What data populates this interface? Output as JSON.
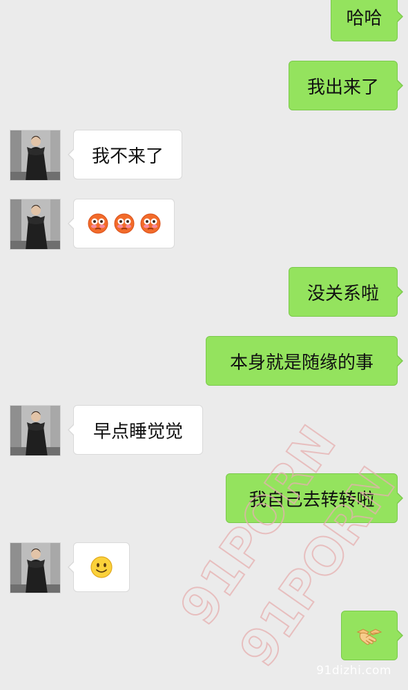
{
  "messages": [
    {
      "side": "out",
      "kind": "text",
      "text": "哈哈"
    },
    {
      "side": "out",
      "kind": "text",
      "text": "我出来了"
    },
    {
      "side": "in",
      "kind": "text",
      "text": "我不来了"
    },
    {
      "side": "in",
      "kind": "emoji",
      "icon": "flushed-face-icon",
      "count": 3
    },
    {
      "side": "out",
      "kind": "text",
      "text": "没关系啦"
    },
    {
      "side": "out",
      "kind": "text",
      "text": "本身就是随缘的事"
    },
    {
      "side": "in",
      "kind": "text",
      "text": "早点睡觉觉"
    },
    {
      "side": "out",
      "kind": "text",
      "text": "我自己去转转啦"
    },
    {
      "side": "in",
      "kind": "emoji",
      "icon": "smiling-face-icon",
      "count": 1
    },
    {
      "side": "out",
      "kind": "emoji",
      "icon": "handshake-icon",
      "count": 1
    }
  ],
  "watermark": {
    "line1": "91PORN",
    "line2": "91PORN"
  },
  "site_mark": "91dizhi.com",
  "colors": {
    "background": "#ebebeb",
    "outgoing_bubble": "#94e35e",
    "incoming_bubble": "#ffffff",
    "watermark": "#e6b0b0"
  }
}
